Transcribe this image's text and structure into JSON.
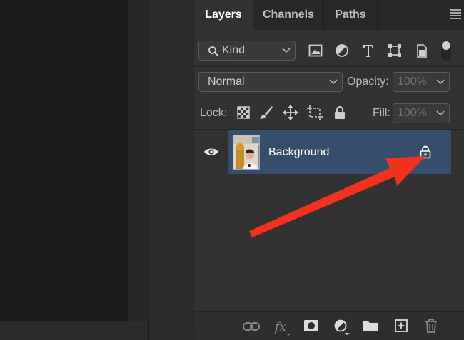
{
  "tabs": [
    {
      "label": "Layers",
      "active": true
    },
    {
      "label": "Channels",
      "active": false
    },
    {
      "label": "Paths",
      "active": false
    }
  ],
  "filter": {
    "label": "Kind",
    "icons": [
      "image-filter-icon",
      "adjustment-filter-icon",
      "type-filter-icon",
      "shape-filter-icon",
      "smart-object-filter-icon"
    ]
  },
  "blend": {
    "mode": "Normal",
    "opacity_label": "Opacity:",
    "opacity_value": "100%"
  },
  "lock": {
    "label": "Lock:",
    "fill_label": "Fill:",
    "fill_value": "100%"
  },
  "layers": [
    {
      "name": "Background",
      "visible": true,
      "locked": true,
      "selected": true
    }
  ],
  "footer_icons": [
    "link-layers-icon",
    "layer-style-fx-icon",
    "layer-mask-icon",
    "adjustment-layer-icon",
    "group-folder-icon",
    "new-layer-icon",
    "trash-icon"
  ],
  "colors": {
    "selected_row": "#344e6b",
    "arrow": "#f2321e",
    "panel": "#323232"
  }
}
